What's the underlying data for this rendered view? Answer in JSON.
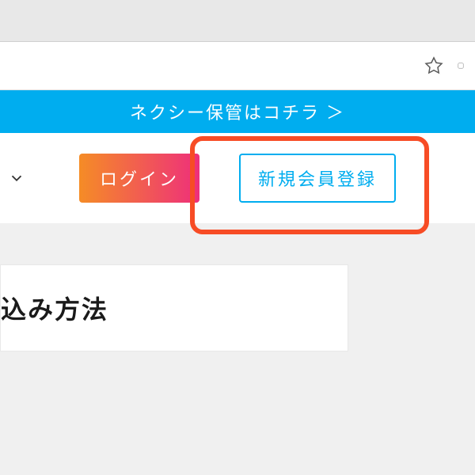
{
  "banner": {
    "text": "ネクシー保管はコチラ ＞"
  },
  "nav": {
    "login_label": "ログイン",
    "signup_label": "新規会員登録"
  },
  "content": {
    "heading": "込み方法"
  }
}
